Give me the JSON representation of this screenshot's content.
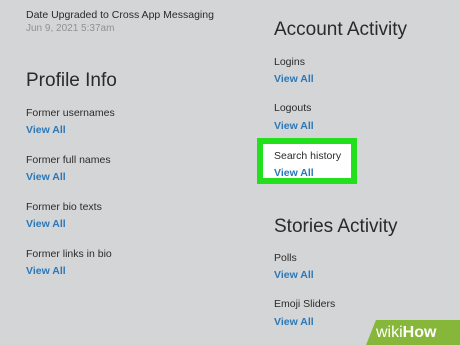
{
  "top": {
    "label": "Date Upgraded to Cross App Messaging",
    "value": "Jun 9, 2021 5:37am"
  },
  "profile": {
    "heading": "Profile Info",
    "items": [
      {
        "label": "Former usernames",
        "link": "View All"
      },
      {
        "label": "Former full names",
        "link": "View All"
      },
      {
        "label": "Former bio texts",
        "link": "View All"
      },
      {
        "label": "Former links in bio",
        "link": "View All"
      }
    ]
  },
  "account": {
    "heading": "Account Activity",
    "items": [
      {
        "label": "Logins",
        "link": "View All"
      },
      {
        "label": "Logouts",
        "link": "View All"
      },
      {
        "label": "Search history",
        "link": "View All"
      }
    ]
  },
  "stories": {
    "heading": "Stories Activity",
    "items": [
      {
        "label": "Polls",
        "link": "View All"
      },
      {
        "label": "Emoji Sliders",
        "link": "View All"
      }
    ]
  },
  "brand": {
    "prefix": "wiki",
    "suffix": "How"
  },
  "colors": {
    "background": "#d4d5d6",
    "link": "#2b78b8",
    "highlight_border": "#22e11c",
    "brand_bg": "#86b73a"
  }
}
